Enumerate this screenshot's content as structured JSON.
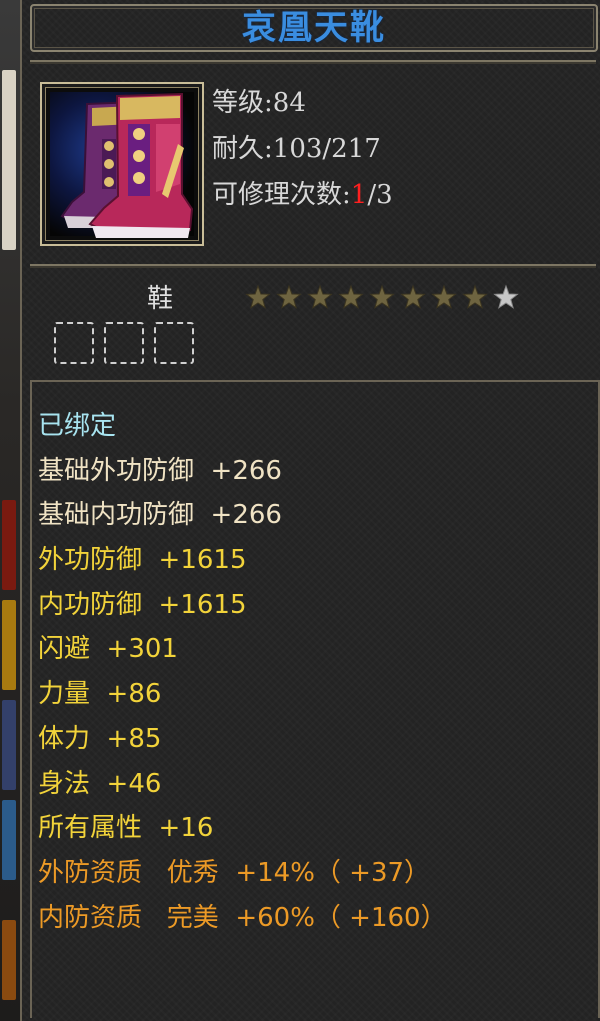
{
  "item": {
    "name": "哀凰天靴",
    "level_label": "等级",
    "level_value": "84",
    "durability_label": "耐久",
    "durability_value": "103/217",
    "repair_label": "可修理次数",
    "repair_used": "1",
    "repair_total": "/3",
    "type": "鞋",
    "stars_total": 9,
    "stars_filled": 8,
    "sockets": 3,
    "icon": "boots-icon"
  },
  "colors": {
    "title": "#3a8de0",
    "bound": "#a8e4f0",
    "base_attr": "#f0e3c4",
    "attr": "#f2d33a",
    "quality": "#ec9a26",
    "repair_used": "#ff2020"
  },
  "attributes": {
    "bound": "已绑定",
    "base_external_defense": "基础外功防御  +266",
    "base_internal_defense": "基础内功防御  +266",
    "external_defense": "外功防御  +1615",
    "internal_defense": "内功防御  +1615",
    "dodge": "闪避  +301",
    "strength": "力量  +86",
    "stamina": "体力  +85",
    "agility": "身法  +46",
    "all_attributes": "所有属性  +16",
    "external_quality": "外防资质   优秀  +14%（ +37）",
    "internal_quality": "内防资质   完美  +60%（ +160）"
  }
}
